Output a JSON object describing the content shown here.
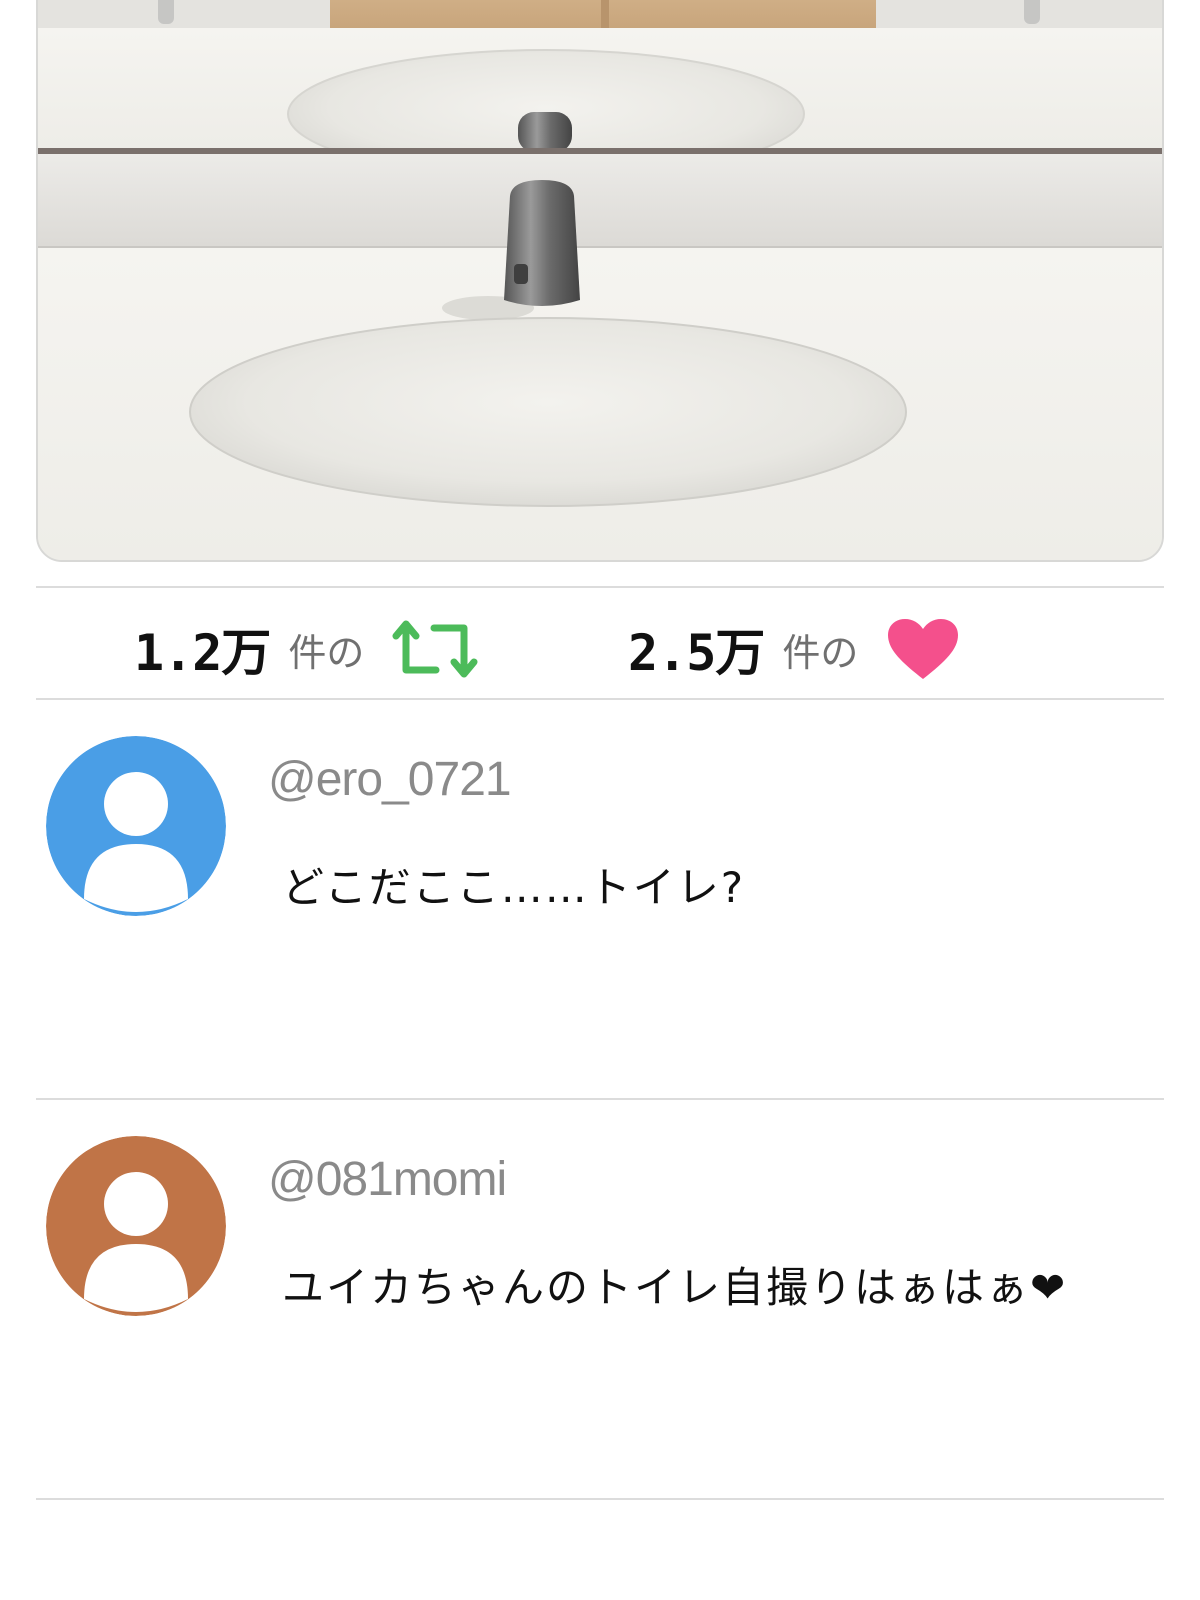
{
  "post": {
    "image_alt": "restroom-sink-illustration"
  },
  "stats": {
    "retweets": {
      "count": "1.2万",
      "unit": "件の",
      "icon": "retweet-icon",
      "color": "#4cbb5a"
    },
    "likes": {
      "count": "2.5万",
      "unit": "件の",
      "icon": "heart-icon",
      "color": "#f4508c"
    }
  },
  "comments": [
    {
      "handle": "@ero_0721",
      "text": "どこだここ……トイレ?",
      "avatar_color": "#4a9ee6",
      "icon": "user-avatar-icon"
    },
    {
      "handle": "@081momi",
      "text": "ユイカちゃんのトイレ自撮りはぁはぁ❤",
      "avatar_color": "#c07447",
      "icon": "user-avatar-icon"
    }
  ]
}
